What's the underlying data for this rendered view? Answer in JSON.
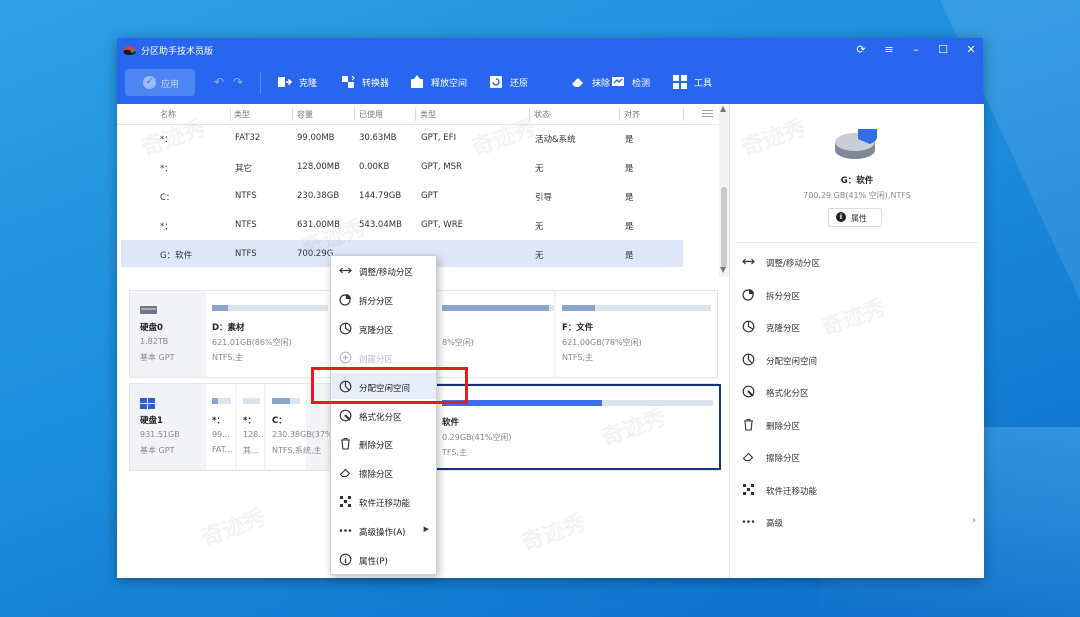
{
  "window": {
    "title": "分区助手技术员版"
  },
  "toolbar": {
    "apply": "应用",
    "buttons": [
      {
        "label": "克隆",
        "icon": "clone-icon"
      },
      {
        "label": "转换器",
        "icon": "converter-icon"
      },
      {
        "label": "释放空间",
        "icon": "free-space-icon"
      },
      {
        "label": "还原",
        "icon": "restore-icon"
      },
      {
        "label": "抹除",
        "icon": "wipe-icon"
      },
      {
        "label": "检测",
        "icon": "check-icon"
      },
      {
        "label": "工具",
        "icon": "tools-icon"
      }
    ]
  },
  "table": {
    "headers": [
      "名称",
      "类型",
      "容量",
      "已使用",
      "类型",
      "状态",
      "对齐"
    ],
    "rows": [
      [
        "*：",
        "FAT32",
        "99.00MB",
        "30.63MB",
        "GPT, EFI",
        "活动&系统",
        "是"
      ],
      [
        "*：",
        "其它",
        "128.00MB",
        "0.00KB",
        "GPT, MSR",
        "无",
        "是"
      ],
      [
        "C：",
        "NTFS",
        "230.38GB",
        "144.79GB",
        "GPT",
        "引导",
        "是"
      ],
      [
        "*：",
        "NTFS",
        "631.00MB",
        "543.04MB",
        "GPT, WRE",
        "无",
        "是"
      ],
      [
        "G：软件",
        "NTFS",
        "700.29G",
        "",
        "",
        "无",
        "是"
      ]
    ]
  },
  "disks": [
    {
      "name": "硬盘0",
      "size": "1.82TB",
      "type": "基本 GPT",
      "partitions": [
        {
          "name": "D：素材",
          "size": "621.01GB(86%空闲)",
          "fs": "NTFS,主",
          "used": 0.14
        },
        {
          "name": "",
          "size": "8%空闲)",
          "fs": "",
          "used": 0.92
        },
        {
          "name": "F：文件",
          "size": "621.00GB(78%空闲)",
          "fs": "NTFS,主",
          "used": 0.22
        }
      ]
    },
    {
      "name": "硬盘1",
      "size": "931.51GB",
      "type": "基本 GPT",
      "partitions": [
        {
          "name": "*：",
          "size": "99...",
          "fs": "FAT...",
          "used": 0.31
        },
        {
          "name": "*：",
          "size": "128...",
          "fs": "其...",
          "used": 0.0
        },
        {
          "name": "C：",
          "size": "230.38GB(37%",
          "fs": "NTFS,系统,主",
          "used": 0.63
        },
        {
          "name": "软件",
          "size": "0.29GB(41%空闲)",
          "fs": "TFS,主",
          "used": 0.59
        }
      ]
    }
  ],
  "context_menu": [
    {
      "label": "调整/移动分区",
      "icon": "resize-move-icon",
      "enabled": true
    },
    {
      "label": "拆分分区",
      "icon": "split-partition-icon",
      "enabled": true
    },
    {
      "label": "克隆分区",
      "icon": "clone-partition-icon",
      "enabled": true
    },
    {
      "label": "创建分区",
      "icon": "create-partition-icon",
      "enabled": false
    },
    {
      "label": "分配空闲空间",
      "icon": "allocate-space-icon",
      "enabled": true,
      "highlighted": true
    },
    {
      "label": "格式化分区",
      "icon": "format-partition-icon",
      "enabled": true
    },
    {
      "label": "删除分区",
      "icon": "delete-partition-icon",
      "enabled": true
    },
    {
      "label": "擦除分区",
      "icon": "wipe-partition-icon",
      "enabled": true
    },
    {
      "label": "软件迁移功能",
      "icon": "app-migrate-icon",
      "enabled": true
    },
    {
      "label": "高级操作(A)",
      "icon": "more-icon",
      "enabled": true,
      "submenu": true
    },
    {
      "label": "属性(P)",
      "icon": "info-icon",
      "enabled": true
    }
  ],
  "right_panel": {
    "title": "G：软件",
    "subtitle": "700.29 GB(41% 空闲),NTFS",
    "properties": "属性",
    "actions": [
      {
        "label": "调整/移动分区",
        "icon": "resize-move-icon"
      },
      {
        "label": "拆分分区",
        "icon": "split-partition-icon"
      },
      {
        "label": "克隆分区",
        "icon": "clone-partition-icon"
      },
      {
        "label": "分配空闲空间",
        "icon": "allocate-space-icon"
      },
      {
        "label": "格式化分区",
        "icon": "format-partition-icon"
      },
      {
        "label": "删除分区",
        "icon": "delete-partition-icon"
      },
      {
        "label": "擦除分区",
        "icon": "wipe-partition-icon"
      },
      {
        "label": "软件迁移功能",
        "icon": "app-migrate-icon"
      },
      {
        "label": "高级",
        "icon": "more-icon",
        "chevron": true
      }
    ],
    "pie_free_fraction": 0.41
  },
  "watermark": "奇迹秀",
  "colors": {
    "brand": "#2866f0",
    "selection": "#dde7f7",
    "highlight_box": "#e02020"
  }
}
